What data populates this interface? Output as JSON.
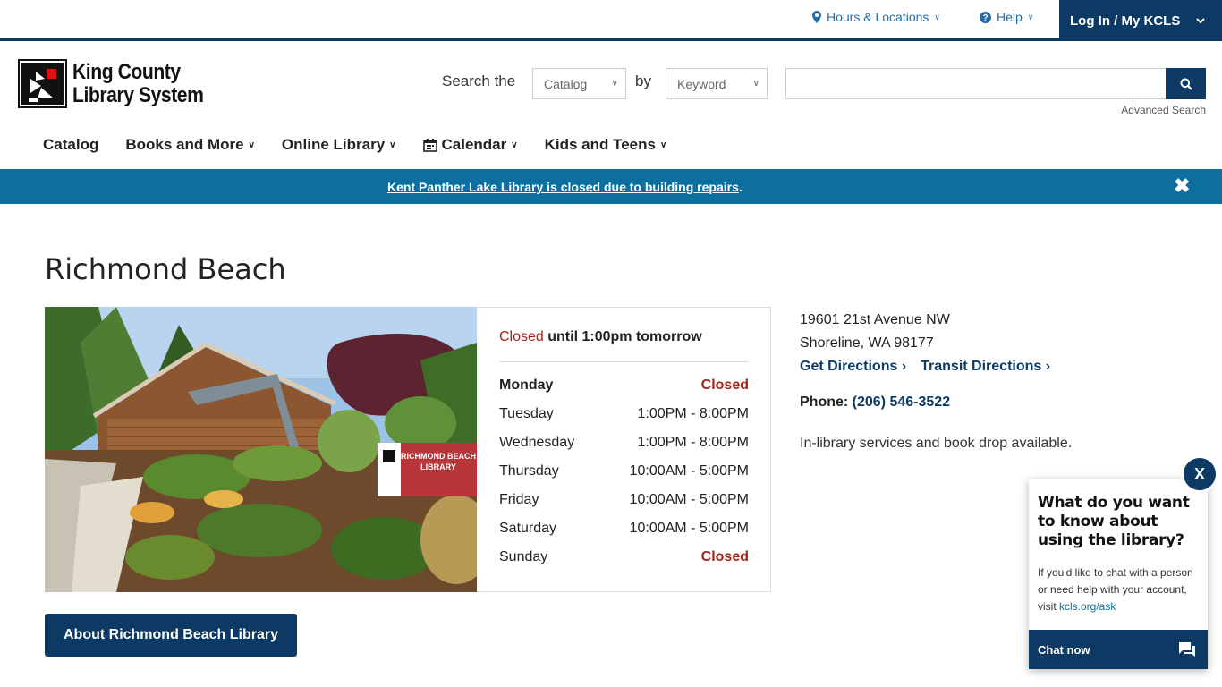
{
  "utility": {
    "hours_locations": "Hours & Locations",
    "help": "Help",
    "login": "Log In / My KCLS"
  },
  "logo": {
    "line1": "King County",
    "line2": "Library System"
  },
  "search": {
    "label_prefix": "Search the",
    "scope_selected": "Catalog",
    "label_by": "by",
    "type_selected": "Keyword",
    "query_value": "",
    "advanced": "Advanced Search"
  },
  "nav": {
    "catalog": "Catalog",
    "books": "Books and More",
    "online": "Online Library",
    "calendar": "Calendar",
    "kids": "Kids and Teens"
  },
  "alert": {
    "text": "Kent Panther Lake Library is closed due to building repairs",
    "suffix": "."
  },
  "page": {
    "title": "Richmond Beach"
  },
  "hours": {
    "status_word": "Closed",
    "status_rest": " until 1:00pm tomorrow",
    "days": [
      {
        "day": "Monday",
        "hours": "Closed"
      },
      {
        "day": "Tuesday",
        "hours": "1:00PM - 8:00PM"
      },
      {
        "day": "Wednesday",
        "hours": "1:00PM - 8:00PM"
      },
      {
        "day": "Thursday",
        "hours": "10:00AM - 5:00PM"
      },
      {
        "day": "Friday",
        "hours": "10:00AM - 5:00PM"
      },
      {
        "day": "Saturday",
        "hours": "10:00AM - 5:00PM"
      },
      {
        "day": "Sunday",
        "hours": "Closed"
      }
    ]
  },
  "location": {
    "street": "19601 21st Avenue NW",
    "city": "Shoreline, WA 98177",
    "directions": "Get Directions",
    "transit": "Transit Directions",
    "phone_label": "Phone:",
    "phone": "(206) 546-3522",
    "note": "In-library services and book drop available."
  },
  "about_button": "About Richmond Beach Library",
  "sign": {
    "line1": "RICHMOND BEACH",
    "line2": "LIBRARY"
  },
  "chat": {
    "close": "X",
    "question": "What do you want to know about using the library?",
    "body": "If you'd like to chat with a person or need help with your account, visit ",
    "link": "kcls.org/ask",
    "button": "Chat now"
  },
  "colors": {
    "navy": "#0d3a64",
    "banner": "#0c6fa0",
    "closed_red": "#a1241a"
  }
}
